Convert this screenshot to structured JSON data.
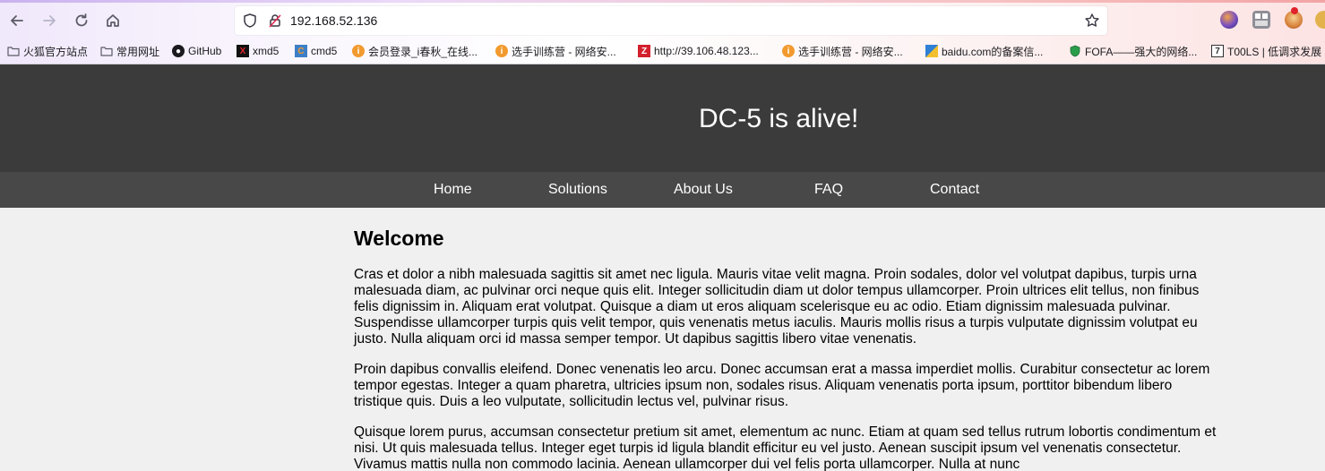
{
  "browser": {
    "url": "192.168.52.136",
    "bookmarks": [
      {
        "label": "火狐官方站点",
        "icon": "folder-icon"
      },
      {
        "label": "常用网址",
        "icon": "folder-icon"
      },
      {
        "label": "GitHub",
        "icon": "github-icon"
      },
      {
        "label": "xmd5",
        "icon": "xmd5-icon"
      },
      {
        "label": "cmd5",
        "icon": "cmd5-icon"
      },
      {
        "label": "会员登录_i春秋_在线...",
        "icon": "ichunqiu-icon"
      },
      {
        "label": "选手训练营 - 网络安...",
        "icon": "ichunqiu-icon"
      },
      {
        "label": "http://39.106.48.123...",
        "icon": "zoomeye-icon"
      },
      {
        "label": "选手训练营 - 网络安...",
        "icon": "ichunqiu-icon"
      },
      {
        "label": "baidu.com的备案信...",
        "icon": "chinaz-icon"
      },
      {
        "label": "FOFA——强大的网络...",
        "icon": "fofa-icon"
      },
      {
        "label": "T00LS | 低调求发展",
        "icon": "t00ls-icon"
      }
    ]
  },
  "site": {
    "title": "DC-5 is alive!",
    "nav": [
      "Home",
      "Solutions",
      "About Us",
      "FAQ",
      "Contact"
    ],
    "heading": "Welcome",
    "paragraphs": [
      "Cras et dolor a nibh malesuada sagittis sit amet nec ligula. Mauris vitae velit magna. Proin sodales, dolor vel volutpat dapibus, turpis urna malesuada diam, ac pulvinar orci neque quis elit. Integer sollicitudin diam ut dolor tempus ullamcorper. Proin ultrices elit tellus, non finibus felis dignissim in. Aliquam erat volutpat. Quisque a diam ut eros aliquam scelerisque eu ac odio. Etiam dignissim malesuada pulvinar. Suspendisse ullamcorper turpis quis velit tempor, quis venenatis metus iaculis. Mauris mollis risus a turpis vulputate dignissim volutpat eu justo. Nulla aliquam orci id massa semper tempor. Ut dapibus sagittis libero vitae venenatis.",
      "Proin dapibus convallis eleifend. Donec venenatis leo arcu. Donec accumsan erat a massa imperdiet mollis. Curabitur consectetur ac lorem tempor egestas. Integer a quam pharetra, ultricies ipsum non, sodales risus. Aliquam venenatis porta ipsum, porttitor bibendum libero tristique quis. Duis a leo vulputate, sollicitudin lectus vel, pulvinar risus.",
      "Quisque lorem purus, accumsan consectetur pretium sit amet, elementum ac nunc. Etiam at quam sed tellus rutrum lobortis condimentum et nisi. Ut quis malesuada tellus. Integer eget turpis id ligula blandit efficitur eu vel justo. Aenean suscipit ipsum vel venenatis consectetur. Vivamus mattis nulla non commodo lacinia. Aenean ullamcorper dui vel felis porta ullamcorper. Nulla at nunc"
    ]
  },
  "colors": {
    "header_bg": "#3b3b3b",
    "nav_bg": "#484848",
    "page_bg": "#f0f0f0"
  }
}
